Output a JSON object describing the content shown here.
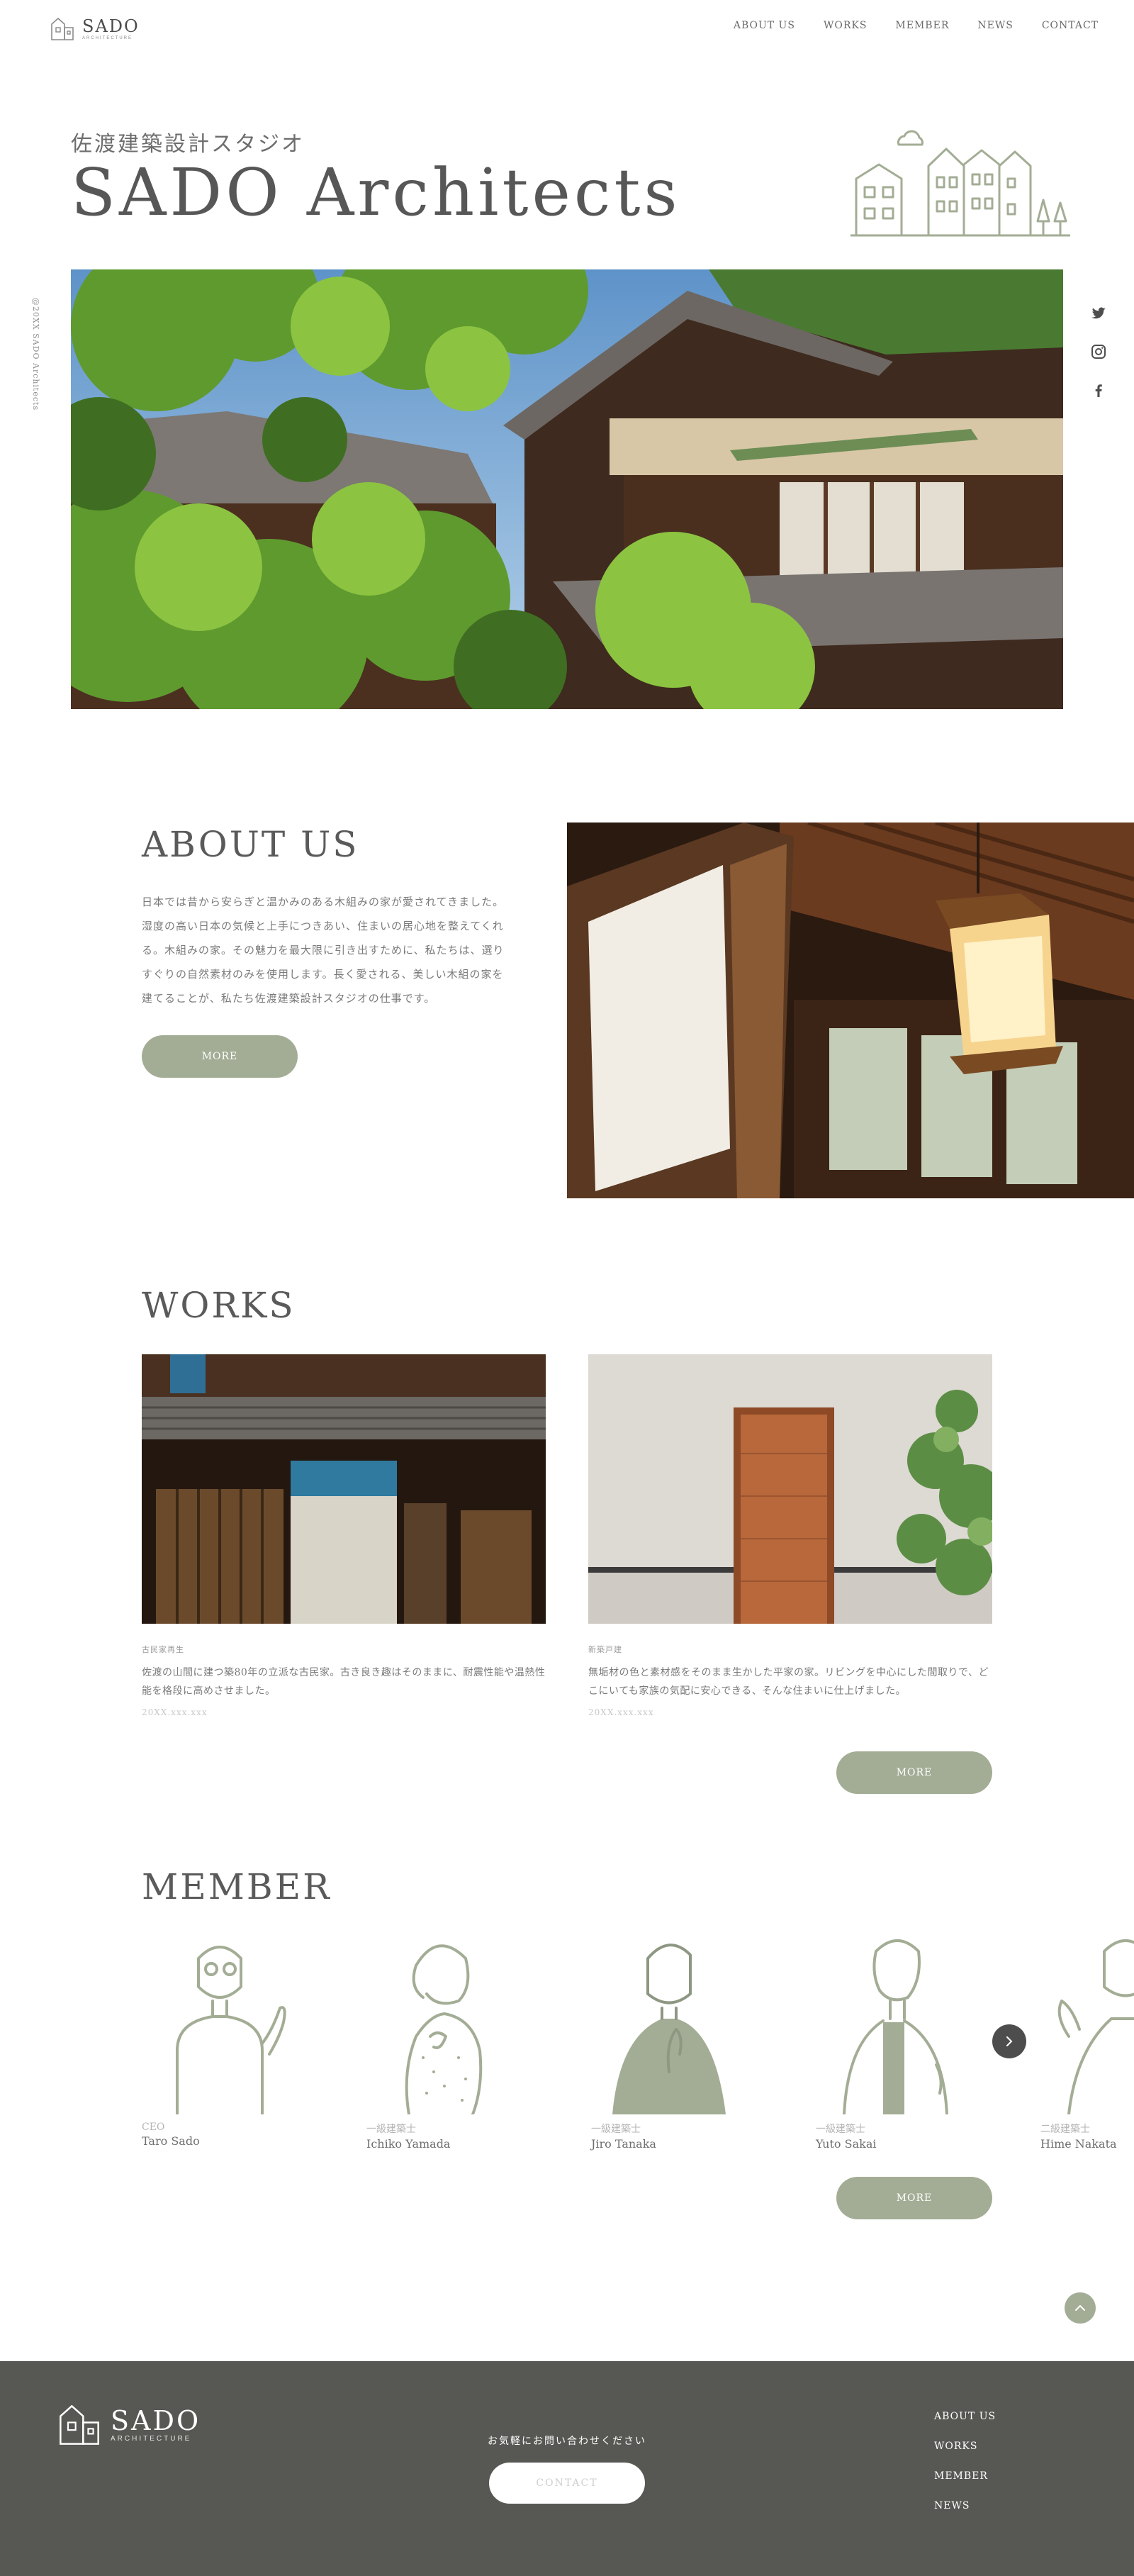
{
  "header": {
    "logo_name": "SADO",
    "logo_sub": "ARCHITECTURE",
    "nav": [
      "ABOUT US",
      "WORKS",
      "MEMBER",
      "NEWS",
      "CONTACT"
    ]
  },
  "hero": {
    "subtitle": "佐渡建築設計スタジオ",
    "title": "SADO Architects",
    "vertical_copyright": "@20XX SADO Architects"
  },
  "social": [
    "twitter-icon",
    "instagram-icon",
    "facebook-icon"
  ],
  "about": {
    "title": "ABOUT US",
    "text": "日本では昔から安らぎと温かみのある木組みの家が愛されてきました。湿度の高い日本の気候と上手につきあい、住まいの居心地を整えてくれる。木組みの家。その魅力を最大限に引き出すために、私たちは、選りすぐりの自然素材のみを使用します。長く愛される、美しい木組の家を建てることが、私たち佐渡建築設計スタジオの仕事です。",
    "button": "MORE"
  },
  "works": {
    "title": "WORKS",
    "items": [
      {
        "category": "古民家再生",
        "description": "佐渡の山間に建つ築80年の立派な古民家。古き良き趣はそのままに、耐震性能や温熱性能を格段に高めさせました。",
        "date": "20XX.xxx.xxx"
      },
      {
        "category": "新築戸建",
        "description": "無垢材の色と素材感をそのまま生かした平家の家。リビングを中心にした間取りで、どこにいても家族の気配に安心できる、そんな住まいに仕上げました。",
        "date": "20XX.xxx.xxx"
      }
    ],
    "button": "MORE"
  },
  "member": {
    "title": "MEMBER",
    "people": [
      {
        "role": "CEO",
        "name": "Taro Sado"
      },
      {
        "role": "一級建築士",
        "name": "Ichiko Yamada"
      },
      {
        "role": "一級建築士",
        "name": "Jiro Tanaka"
      },
      {
        "role": "一級建築士",
        "name": "Yuto Sakai"
      },
      {
        "role": "二級建築士",
        "name": "Hime Nakata"
      }
    ],
    "button": "MORE"
  },
  "footer": {
    "logo_name": "SADO",
    "logo_sub": "ARCHITECTURE",
    "cta": "お気軽にお問い合わせください",
    "contact_button": "CONTACT",
    "nav": [
      "ABOUT US",
      "WORKS",
      "MEMBER",
      "NEWS"
    ]
  },
  "colors": {
    "accent": "#a3ad95",
    "footer_bg": "#575854",
    "text": "#5a5a5a"
  }
}
